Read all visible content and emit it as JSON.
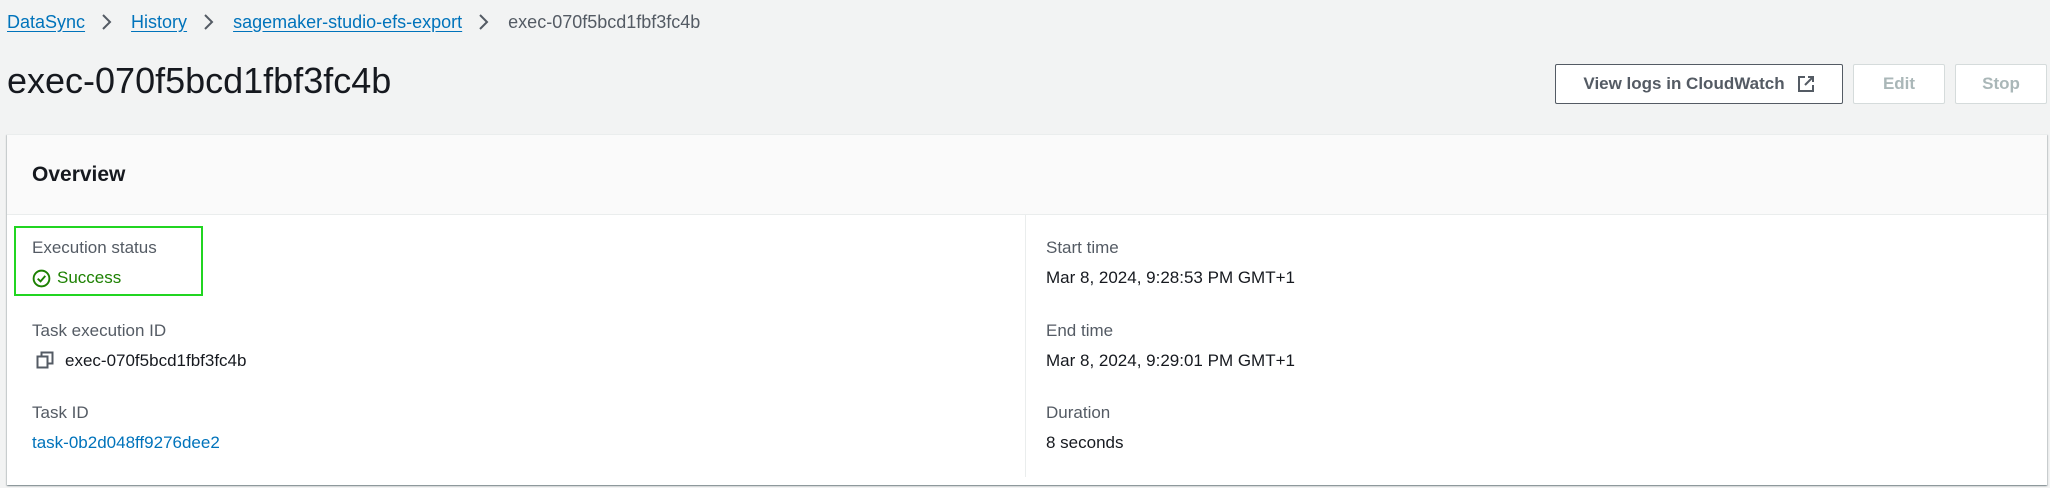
{
  "breadcrumb": {
    "items": [
      "DataSync",
      "History",
      "sagemaker-studio-efs-export"
    ],
    "current": "exec-070f5bcd1fbf3fc4b"
  },
  "page": {
    "title": "exec-070f5bcd1fbf3fc4b"
  },
  "actions": {
    "view_logs_label": "View logs in CloudWatch",
    "edit_label": "Edit",
    "stop_label": "Stop"
  },
  "overview": {
    "title": "Overview",
    "execution_status": {
      "label": "Execution status",
      "value": "Success"
    },
    "task_execution_id": {
      "label": "Task execution ID",
      "value": "exec-070f5bcd1fbf3fc4b"
    },
    "task_id": {
      "label": "Task ID",
      "value": "task-0b2d048ff9276dee2"
    },
    "start_time": {
      "label": "Start time",
      "value": "Mar 8, 2024, 9:28:53 PM GMT+1"
    },
    "end_time": {
      "label": "End time",
      "value": "Mar 8, 2024, 9:29:01 PM GMT+1"
    },
    "duration": {
      "label": "Duration",
      "value": "8 seconds"
    }
  },
  "colors": {
    "link": "#0073bb",
    "success": "#1d8102",
    "highlight": "#21d521",
    "background": "#f2f3f3"
  },
  "icons": {
    "breadcrumb_separator": "chevron-right-icon",
    "external_link": "external-link-icon",
    "status": "check-circle-icon",
    "copy": "copy-icon"
  }
}
